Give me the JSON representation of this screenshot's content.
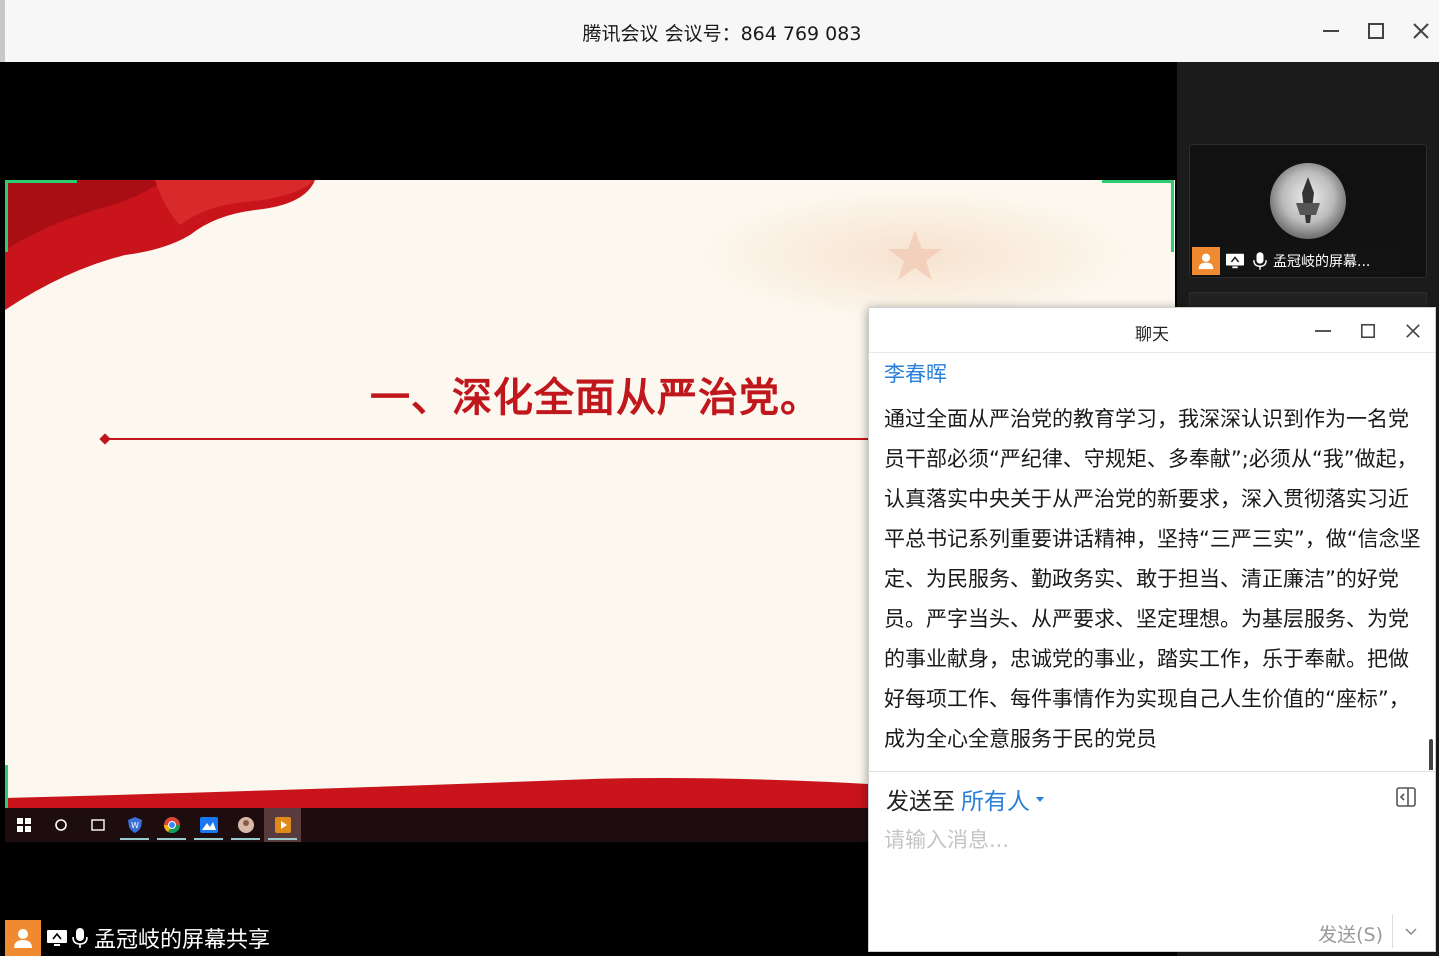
{
  "window": {
    "title": "腾讯会议 会议号：864 769 083",
    "minimize_icon": "minimize-icon",
    "maximize_icon": "maximize-icon",
    "close_icon": "close-icon"
  },
  "slide": {
    "title": "一、深化全面从严治党。",
    "accent_color": "#c0171c"
  },
  "shared_screen_taskbar": {
    "items": [
      "windows-start-icon",
      "search-circle-icon",
      "task-view-icon",
      "browser-shield-icon",
      "chrome-icon",
      "app-blue-icon",
      "avatar-app-icon",
      "media-player-icon"
    ]
  },
  "share_label": {
    "text": "孟冠岐的屏幕共享"
  },
  "participant": {
    "name": "孟冠岐的屏幕..."
  },
  "chat": {
    "title": "聊天",
    "sender": "李春晖",
    "message": "通过全面从严治党的教育学习，我深深认识到作为一名党员干部必须“严纪律、守规矩、多奉献”;必须从“我”做起，认真落实中央关于从严治党的新要求，深入贯彻落实习近平总书记系列重要讲话精神，坚持“三严三实”，做“信念坚定、为民服务、勤政务实、敢于担当、清正廉洁”的好党员。严字当头、从严要求、坚定理想。为基层服务、为党的事业献身，忠诚党的事业，踏实工作，乐于奉献。把做好每项工作、每件事情作为实现自己人生价值的“座标”，成为全心全意服务于民的党员",
    "send_to_label": "发送至",
    "send_to_target": "所有人",
    "input_placeholder": "请输入消息...",
    "send_button": "发送(S)",
    "link_color": "#2a7fd8"
  }
}
